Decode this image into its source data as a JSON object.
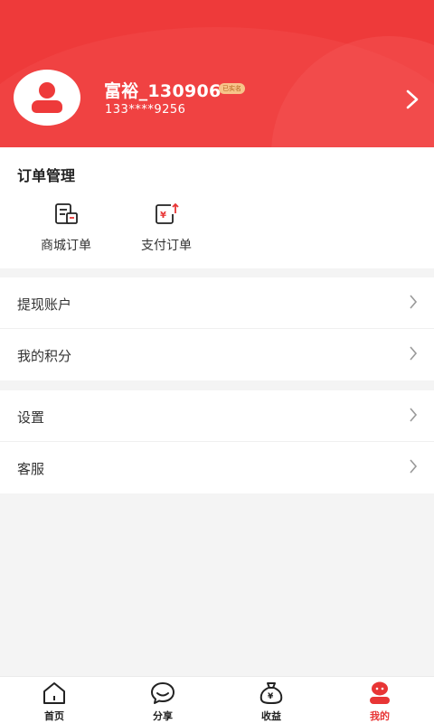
{
  "header": {
    "username": "富裕_130906",
    "verified_badge": "已实名",
    "phone": "133****9256",
    "bg_color": "#ee3a3a"
  },
  "orders": {
    "title": "订单管理",
    "items": [
      {
        "label": "商城订单",
        "icon": "shop-order-icon"
      },
      {
        "label": "支付订单",
        "icon": "payment-order-icon"
      }
    ]
  },
  "menu": {
    "group1": [
      {
        "label": "提现账户"
      },
      {
        "label": "我的积分"
      }
    ],
    "group2": [
      {
        "label": "设置"
      },
      {
        "label": "客服"
      }
    ]
  },
  "tabbar": {
    "tabs": [
      {
        "label": "首页",
        "icon": "home-icon"
      },
      {
        "label": "分享",
        "icon": "share-icon"
      },
      {
        "label": "收益",
        "icon": "money-bag-icon"
      },
      {
        "label": "我的",
        "icon": "profile-icon",
        "active": true
      }
    ],
    "active_color": "#e83535"
  }
}
